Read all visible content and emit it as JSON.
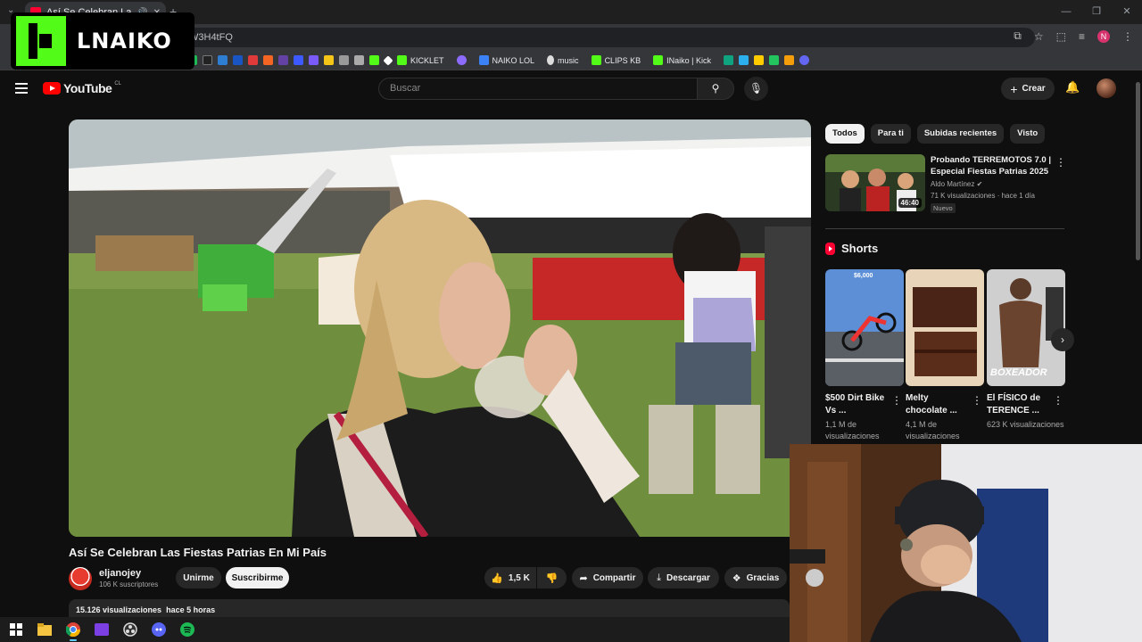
{
  "browser": {
    "tab_title": "Así Se Celebran Las Fiestas",
    "url_fragment": "W3H4tFQ",
    "bookmarks": [
      "KICKLET",
      "NAIKO LOL",
      "music",
      "CLIPS KB",
      "INaiko | Kick"
    ],
    "profile_initial": "N"
  },
  "overlay": {
    "brand": "LNAIKO"
  },
  "youtube": {
    "logo_text": "YouTube",
    "country_code": "CL",
    "search_placeholder": "Buscar",
    "create_label": "Crear"
  },
  "video": {
    "title": "Así Se Celebran Las Fiestas Patrias En Mi País",
    "channel_name": "eljanojey",
    "subscribers": "106 K suscriptores",
    "join_label": "Unirme",
    "subscribe_label": "Suscribirme",
    "likes": "1,5 K",
    "share_label": "Compartir",
    "download_label": "Descargar",
    "thanks_label": "Gracias",
    "views": "15.126 visualizaciones",
    "age": "hace 5 horas"
  },
  "sidebar": {
    "chips": [
      "Todos",
      "Para ti",
      "Subidas recientes",
      "Visto"
    ],
    "recommendation": {
      "title": "Probando TERREMOTOS 7.0 | Especial Fiestas Patrias 2025",
      "channel": "Aldo Martínez",
      "meta": "71 K visualizaciones · hace 1 día",
      "badge": "Nuevo",
      "duration": "46:40"
    },
    "shorts_heading": "Shorts",
    "shorts": [
      {
        "title": "$500 Dirt Bike Vs ...",
        "views": "1,1 M de visualizaciones",
        "overlay": "$6,000"
      },
      {
        "title": "Melty chocolate ...",
        "views": "4,1 M de visualizaciones",
        "overlay": ""
      },
      {
        "title": "El FÍSICO de TERENCE ...",
        "views": "623 K visualizaciones",
        "overlay": "BOXEADOR"
      }
    ]
  },
  "colors": {
    "kick_green": "#53fc18",
    "youtube_red": "#ff0000",
    "background": "#0f0f0f"
  }
}
